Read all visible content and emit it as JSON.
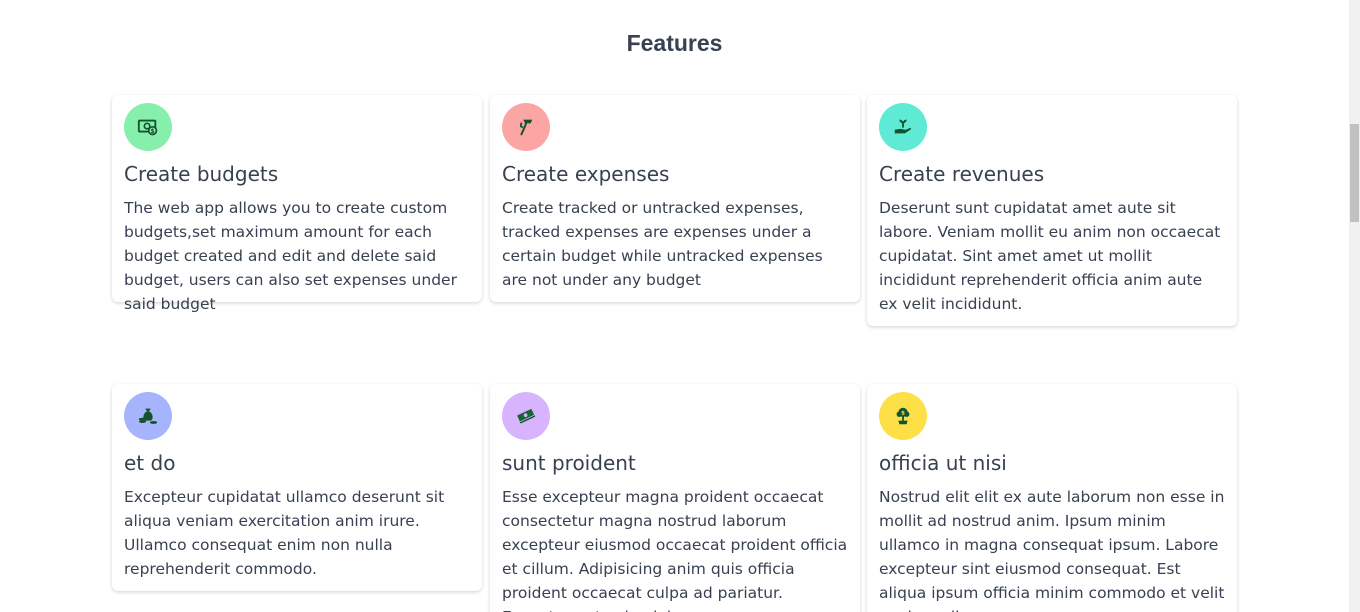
{
  "section": {
    "title": "Features"
  },
  "features": [
    {
      "title": "Create budgets",
      "description": "The web app allows you to create custom budgets,set maximum amount for each budget created and edit and delete said budget, users can also set expenses under said budget",
      "icon": "money-bill-icon",
      "color": "#86efac"
    },
    {
      "title": "Create expenses",
      "description": "Create tracked or untracked expenses, tracked expenses are expenses under a certain budget while untracked expenses are not under any budget",
      "icon": "hand-holding-money-icon",
      "color": "#fca5a5"
    },
    {
      "title": "Create revenues",
      "description": "Deserunt sunt cupidatat amet aute sit labore. Veniam mollit eu anim non occaecat cupidatat. Sint amet amet ut mollit incididunt reprehenderit officia anim aute ex velit incididunt.",
      "icon": "hand-holding-plant-icon",
      "color": "#5eead4"
    },
    {
      "title": "et do",
      "description": "Excepteur cupidatat ullamco deserunt sit aliqua veniam exercitation anim irure. Ullamco consequat enim non nulla reprehenderit commodo.",
      "icon": "money-bag-coins-icon",
      "color": "#a5b4fc"
    },
    {
      "title": "sunt proident",
      "description": "Esse excepteur magna proident occaecat consectetur magna nostrud laborum excepteur eiusmod occaecat proident officia et cillum. Adipisicing anim quis officia proident occaecat culpa ad pariatur. Excepteur ut culpa labore",
      "icon": "cash-stack-icon",
      "color": "#d8b4fe"
    },
    {
      "title": "officia ut nisi",
      "description": "Nostrud elit elit ex aute laborum non esse in mollit ad nostrud anim. Ipsum minim ullamco in magna consequat ipsum. Labore excepteur sint eiusmod consequat. Est aliqua ipsum officia minim commodo et velit veniam aliqua",
      "icon": "money-tree-icon",
      "color": "#fde047"
    }
  ]
}
